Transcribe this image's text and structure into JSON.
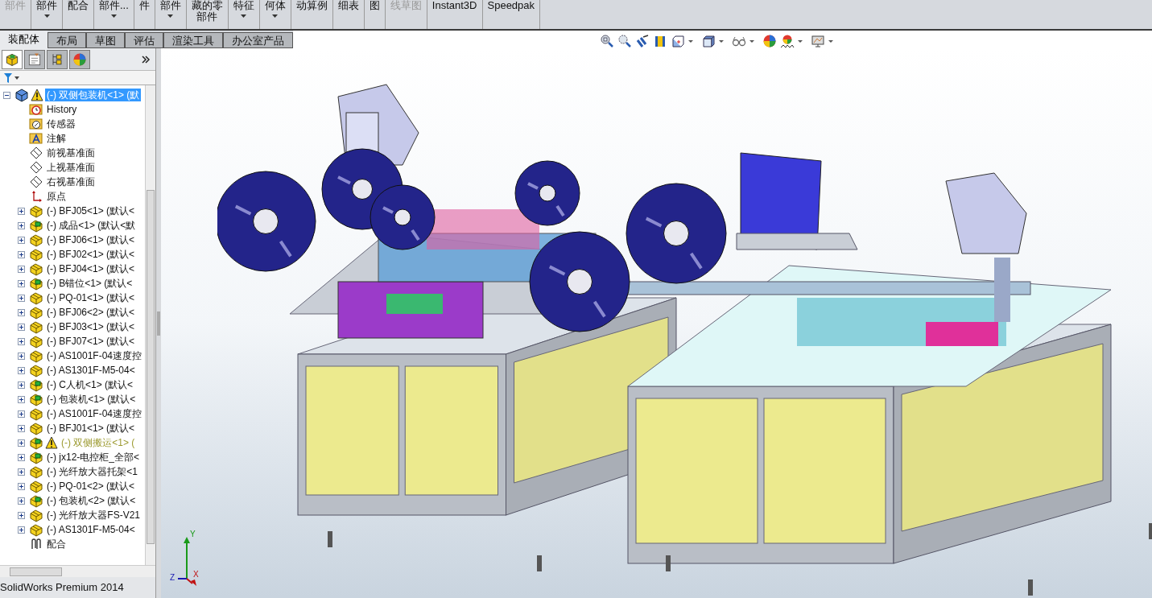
{
  "toolbar": {
    "buttons": [
      {
        "lines": [
          "部件"
        ],
        "caret": false,
        "disabled": true
      },
      {
        "lines": [
          "部件"
        ],
        "caret": true,
        "disabled": false
      },
      {
        "lines": [
          "配合"
        ],
        "caret": false,
        "disabled": false
      },
      {
        "lines": [
          "部件..."
        ],
        "caret": true,
        "disabled": false
      },
      {
        "lines": [
          "件"
        ],
        "caret": false,
        "disabled": false
      },
      {
        "lines": [
          "部件"
        ],
        "caret": true,
        "disabled": false
      },
      {
        "lines": [
          "藏的零",
          "部件"
        ],
        "caret": false,
        "disabled": false
      },
      {
        "lines": [
          "特征"
        ],
        "caret": true,
        "disabled": false
      },
      {
        "lines": [
          "何体"
        ],
        "caret": true,
        "disabled": false
      },
      {
        "lines": [
          "动算例"
        ],
        "caret": false,
        "disabled": false
      },
      {
        "lines": [
          "细表"
        ],
        "caret": false,
        "disabled": false
      },
      {
        "lines": [
          "图"
        ],
        "caret": false,
        "disabled": false
      },
      {
        "lines": [
          "线草图"
        ],
        "caret": false,
        "disabled": true
      },
      {
        "lines": [
          "Instant3D"
        ],
        "caret": false,
        "disabled": false
      },
      {
        "lines": [
          "Speedpak"
        ],
        "caret": false,
        "disabled": false
      }
    ]
  },
  "tabs": [
    {
      "label": "装配体",
      "selected": true
    },
    {
      "label": "布局",
      "selected": false
    },
    {
      "label": "草图",
      "selected": false
    },
    {
      "label": "评估",
      "selected": false
    },
    {
      "label": "渲染工具",
      "selected": false
    },
    {
      "label": "办公室产品",
      "selected": false
    }
  ],
  "manager_tabs": [
    {
      "kind": "tree",
      "selected": true
    },
    {
      "kind": "property",
      "selected": false
    },
    {
      "kind": "config",
      "selected": false
    },
    {
      "kind": "display",
      "selected": false
    }
  ],
  "tree": [
    {
      "label": "(-) 双侧包装机<1> (默",
      "kind": "assembly",
      "warning": true,
      "selected": true,
      "dimmed": false,
      "expanded": true,
      "children": [
        {
          "label": "History",
          "kind": "history",
          "warning": false,
          "selected": false,
          "dimmed": false
        },
        {
          "label": "传感器",
          "kind": "sensor",
          "warning": false,
          "selected": false,
          "dimmed": false
        },
        {
          "label": "注解",
          "kind": "annotation",
          "warning": false,
          "selected": false,
          "dimmed": false
        },
        {
          "label": "前视基准面",
          "kind": "plane",
          "warning": false,
          "selected": false,
          "dimmed": false
        },
        {
          "label": "上视基准面",
          "kind": "plane",
          "warning": false,
          "selected": false,
          "dimmed": false
        },
        {
          "label": "右视基准面",
          "kind": "plane",
          "warning": false,
          "selected": false,
          "dimmed": false
        },
        {
          "label": "原点",
          "kind": "origin",
          "warning": false,
          "selected": false,
          "dimmed": false
        },
        {
          "label": "(-) BFJ05<1> (默认<",
          "kind": "part",
          "warning": false,
          "selected": false,
          "dimmed": false,
          "expanded": false
        },
        {
          "label": "(-) 成品<1> (默认<默",
          "kind": "subassembly",
          "warning": false,
          "selected": false,
          "dimmed": false,
          "expanded": false
        },
        {
          "label": "(-) BFJ06<1> (默认<",
          "kind": "part",
          "warning": false,
          "selected": false,
          "dimmed": false,
          "expanded": false
        },
        {
          "label": "(-) BFJ02<1> (默认<",
          "kind": "part",
          "warning": false,
          "selected": false,
          "dimmed": false,
          "expanded": false
        },
        {
          "label": "(-) BFJ04<1> (默认<",
          "kind": "part",
          "warning": false,
          "selected": false,
          "dimmed": false,
          "expanded": false
        },
        {
          "label": "(-) B错位<1> (默认<",
          "kind": "subassembly",
          "warning": false,
          "selected": false,
          "dimmed": false,
          "expanded": false
        },
        {
          "label": "(-) PQ-01<1> (默认<",
          "kind": "part",
          "warning": false,
          "selected": false,
          "dimmed": false,
          "expanded": false
        },
        {
          "label": "(-) BFJ06<2> (默认<",
          "kind": "part",
          "warning": false,
          "selected": false,
          "dimmed": false,
          "expanded": false
        },
        {
          "label": "(-) BFJ03<1> (默认<",
          "kind": "part",
          "warning": false,
          "selected": false,
          "dimmed": false,
          "expanded": false
        },
        {
          "label": "(-) BFJ07<1> (默认<",
          "kind": "part",
          "warning": false,
          "selected": false,
          "dimmed": false,
          "expanded": false
        },
        {
          "label": "(-) AS1001F-04速度控",
          "kind": "part",
          "warning": false,
          "selected": false,
          "dimmed": false,
          "expanded": false
        },
        {
          "label": "(-) AS1301F-M5-04<",
          "kind": "part",
          "warning": false,
          "selected": false,
          "dimmed": false,
          "expanded": false
        },
        {
          "label": "(-) C人机<1> (默认<",
          "kind": "subassembly",
          "warning": false,
          "selected": false,
          "dimmed": false,
          "expanded": false
        },
        {
          "label": "(-) 包装机<1> (默认<",
          "kind": "subassembly",
          "warning": false,
          "selected": false,
          "dimmed": false,
          "expanded": false
        },
        {
          "label": "(-) AS1001F-04速度控",
          "kind": "part",
          "warning": false,
          "selected": false,
          "dimmed": false,
          "expanded": false
        },
        {
          "label": "(-) BFJ01<1> (默认<",
          "kind": "part",
          "warning": false,
          "selected": false,
          "dimmed": false,
          "expanded": false
        },
        {
          "label": "(-) 双侧搬运<1> (",
          "kind": "subassembly",
          "warning": true,
          "selected": false,
          "dimmed": true,
          "expanded": false
        },
        {
          "label": "(-) jx12-电控柜_全部<",
          "kind": "subassembly",
          "warning": false,
          "selected": false,
          "dimmed": false,
          "expanded": false
        },
        {
          "label": "(-) 光纤放大器托架<1",
          "kind": "part",
          "warning": false,
          "selected": false,
          "dimmed": false,
          "expanded": false
        },
        {
          "label": "(-) PQ-01<2> (默认<",
          "kind": "part",
          "warning": false,
          "selected": false,
          "dimmed": false,
          "expanded": false
        },
        {
          "label": "(-) 包装机<2> (默认<",
          "kind": "subassembly",
          "warning": false,
          "selected": false,
          "dimmed": false,
          "expanded": false
        },
        {
          "label": "(-) 光纤放大器FS-V21",
          "kind": "part",
          "warning": false,
          "selected": false,
          "dimmed": false,
          "expanded": false
        },
        {
          "label": "(-) AS1301F-M5-04<",
          "kind": "part",
          "warning": false,
          "selected": false,
          "dimmed": false,
          "expanded": false
        },
        {
          "label": "配合",
          "kind": "mates",
          "warning": false,
          "selected": false,
          "dimmed": false
        }
      ]
    }
  ],
  "view_toolbar": [
    {
      "kind": "zoom-fit",
      "caret": false
    },
    {
      "kind": "zoom-area",
      "caret": false
    },
    {
      "kind": "previous-view",
      "caret": false
    },
    {
      "kind": "section",
      "caret": false
    },
    {
      "kind": "orientation",
      "caret": true
    },
    {
      "kind": "display-style",
      "caret": true
    },
    {
      "kind": "hide-show",
      "caret": true
    },
    {
      "kind": "appearance",
      "caret": false
    },
    {
      "kind": "scene",
      "caret": true
    },
    {
      "kind": "display-settings",
      "caret": true
    }
  ],
  "triad": {
    "y": "Y",
    "z": "Z",
    "x": "X"
  },
  "status_bar": {
    "text": "SolidWorks Premium 2014"
  }
}
